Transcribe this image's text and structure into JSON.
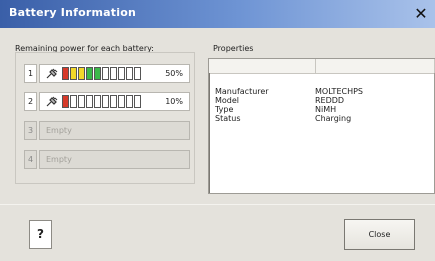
{
  "window": {
    "title": "Battery Information",
    "close_glyph": "✕"
  },
  "left_group": {
    "label": "Remaining power for each battery:",
    "slots": [
      {
        "num": "1",
        "state": "charged",
        "percent_text": "50%",
        "level": 0.5,
        "plug_icon": "plug-icon"
      },
      {
        "num": "2",
        "state": "charged",
        "percent_text": "10%",
        "level": 0.1,
        "plug_icon": "plug-icon"
      },
      {
        "num": "3",
        "state": "empty",
        "empty_text": "Empty"
      },
      {
        "num": "4",
        "state": "empty",
        "empty_text": "Empty"
      }
    ],
    "colors": {
      "red": "#d63a2a",
      "yellow": "#f2d82a",
      "green": "#3cb84a",
      "empty_segment": "#ffffff"
    }
  },
  "right_group": {
    "label": "Properties",
    "properties": [
      {
        "key": "Manufacturer",
        "value": "MOLTECHPS"
      },
      {
        "key": "Model",
        "value": "REDDD"
      },
      {
        "key": "Type",
        "value": "NiMH"
      },
      {
        "key": "Status",
        "value": "Charging"
      }
    ]
  },
  "buttons": {
    "help_label": "?",
    "close_label": "Close"
  }
}
